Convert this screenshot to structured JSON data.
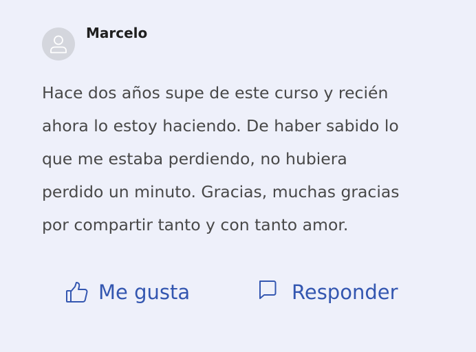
{
  "comment": {
    "author": "Marcelo",
    "body_lines": [
      "Hace dos años supe de este curso y recién",
      "ahora lo estoy haciendo. De haber sabido lo",
      "que me estaba perdiendo, no hubiera",
      "perdido un minuto. Gracias, muchas gracias",
      "por compartir tanto y con tanto amor."
    ]
  },
  "actions": {
    "like_label": "Me gusta",
    "reply_label": "Responder"
  },
  "icons": {
    "avatar": "user-icon",
    "like": "thumbs-up-icon",
    "reply": "speech-bubble-icon"
  },
  "colors": {
    "background": "#eef0fa",
    "action": "#3356b0",
    "text": "#484848",
    "author": "#1f1f1f",
    "avatar_bg": "#d4d6dd"
  }
}
